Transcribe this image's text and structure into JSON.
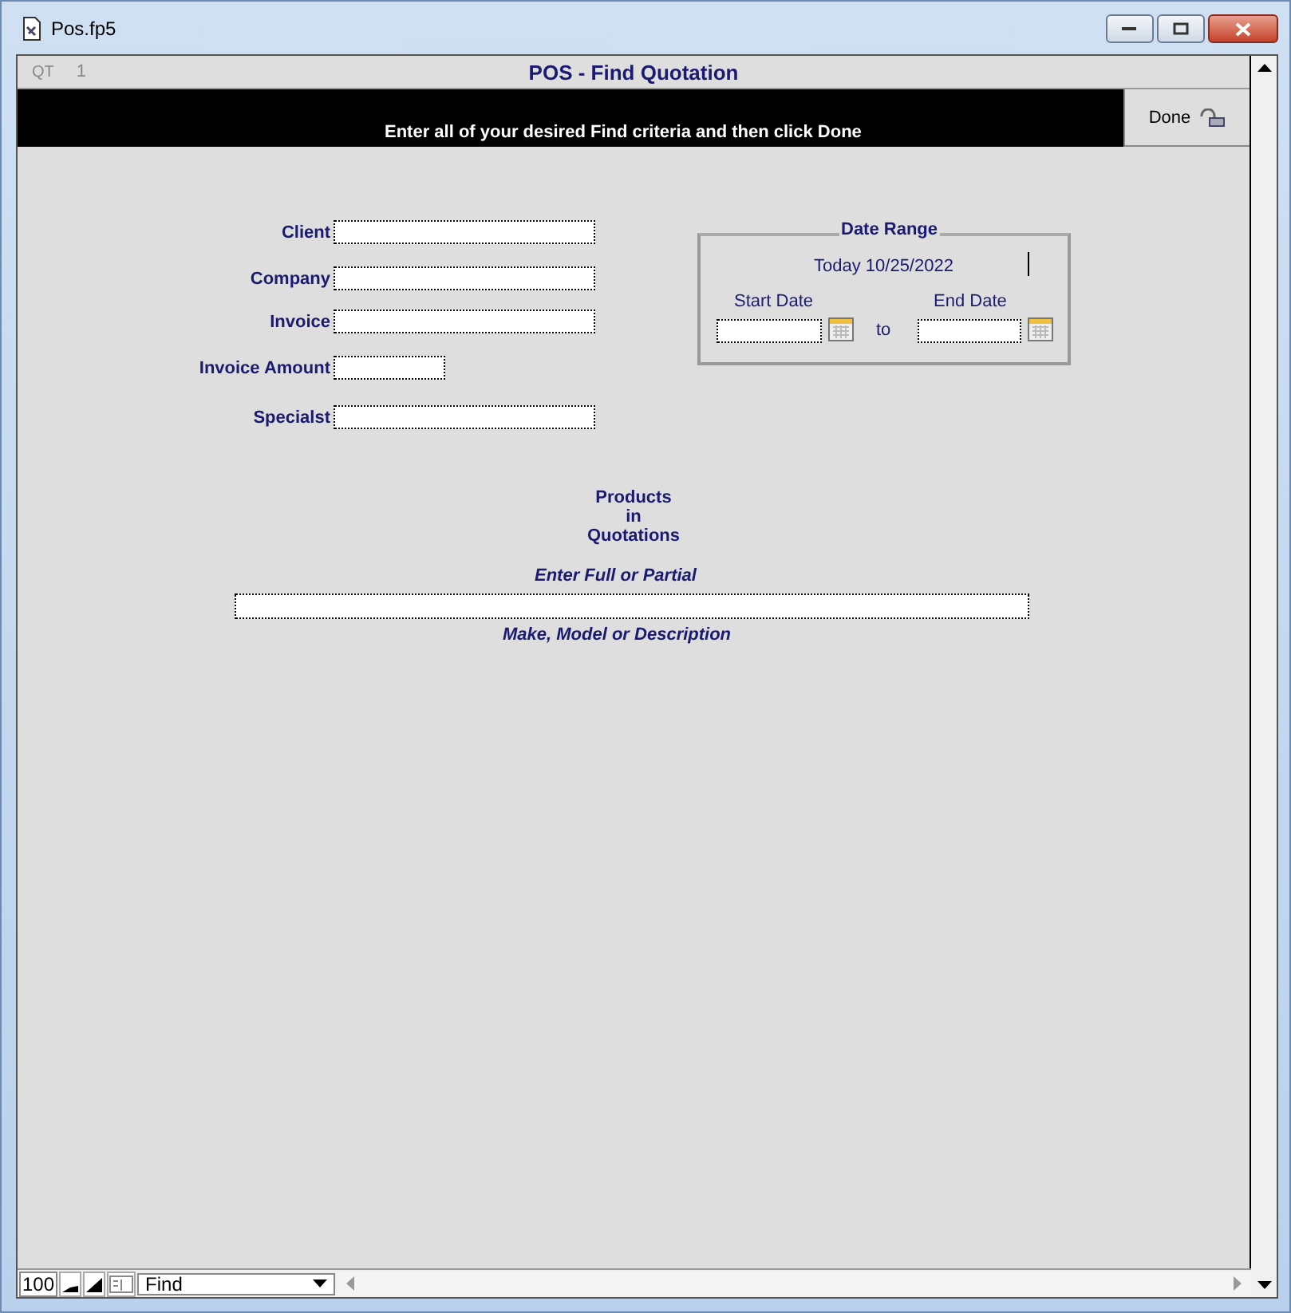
{
  "window": {
    "title": "Pos.fp5"
  },
  "header": {
    "record_code": "QT",
    "record_number": "1",
    "title": "POS - Find Quotation"
  },
  "banner": {
    "message": "Enter all of your desired Find criteria and then click Done",
    "done_button": "Done"
  },
  "fields": [
    {
      "label": "Client",
      "kind": "wide"
    },
    {
      "label": "Company",
      "kind": "wide"
    },
    {
      "label": "Invoice",
      "kind": "wide"
    },
    {
      "label": "Invoice Amount",
      "kind": "narrow"
    },
    {
      "label": "Specialst",
      "kind": "wide"
    }
  ],
  "date_range": {
    "title": "Date Range",
    "today": "Today 10/25/2022",
    "start_label": "Start Date",
    "end_label": "End Date",
    "separator": "to"
  },
  "products": {
    "heading": [
      "Products",
      "in",
      "Quotations"
    ],
    "hint_above": "Enter Full or Partial",
    "hint_below": "Make, Model or Description"
  },
  "status_bar": {
    "zoom": "100",
    "mode": "Find"
  }
}
